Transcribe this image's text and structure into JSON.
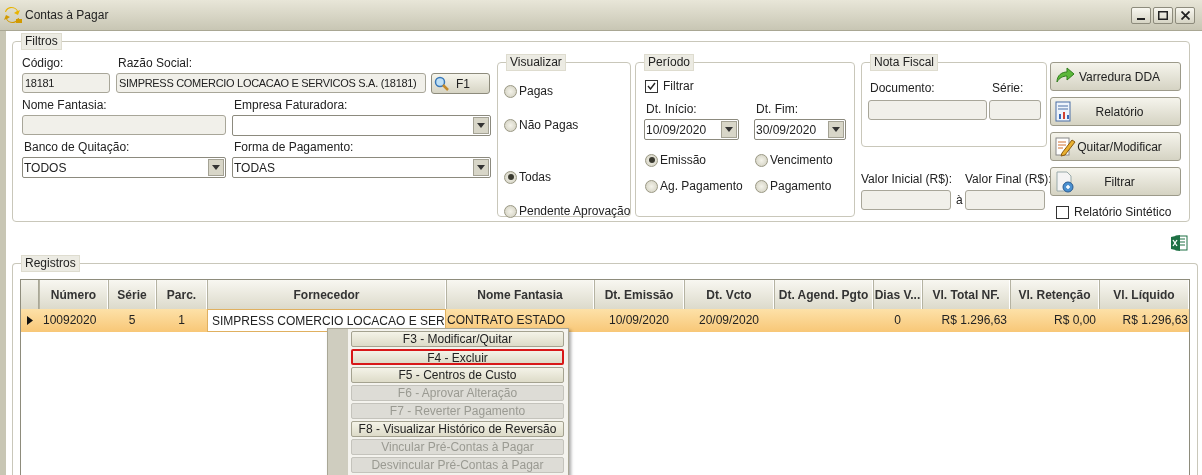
{
  "window": {
    "title": "Contas à Pagar"
  },
  "filtros": {
    "legend": "Filtros",
    "codigo": {
      "label": "Código:",
      "value": "18181"
    },
    "razao_social": {
      "label": "Razão Social:",
      "value": "SIMPRESS COMERCIO LOCACAO E SERVICOS S.A. (18181)"
    },
    "search_button": "F1",
    "nome_fantasia": {
      "label": "Nome Fantasia:"
    },
    "empresa_faturadora": {
      "label": "Empresa Faturadora:"
    },
    "banco_quitacao": {
      "label": "Banco de Quitação:",
      "value": "TODOS"
    },
    "forma_pagamento": {
      "label": "Forma de Pagamento:",
      "value": "TODAS"
    },
    "visualizar": {
      "legend": "Visualizar",
      "options": [
        {
          "label": "Pagas",
          "selected": false
        },
        {
          "label": "Não Pagas",
          "selected": false
        },
        {
          "label": "Todas",
          "selected": true
        },
        {
          "label": "Pendente Aprovação",
          "selected": false
        }
      ]
    },
    "periodo": {
      "legend": "Período",
      "filtrar": {
        "label": "Filtrar",
        "checked": true
      },
      "dt_inicio": {
        "label": "Dt. Início:",
        "value": "10/09/2020"
      },
      "dt_fim": {
        "label": "Dt. Fim:",
        "value": "30/09/2020"
      },
      "options": [
        {
          "label": "Emissão",
          "selected": true
        },
        {
          "label": "Vencimento",
          "selected": false
        },
        {
          "label": "Ag. Pagamento",
          "selected": false
        },
        {
          "label": "Pagamento",
          "selected": false
        }
      ]
    },
    "nota_fiscal": {
      "legend": "Nota Fiscal",
      "documento": {
        "label": "Documento:"
      },
      "serie": {
        "label": "Série:"
      }
    },
    "valor_inicial": {
      "label": "Valor Inicial (R$):"
    },
    "separator": "à",
    "valor_final": {
      "label": "Valor Final (R$):"
    },
    "buttons": [
      "Varredura DDA",
      "Relatório",
      "Quitar/Modificar",
      "Filtrar"
    ],
    "relatorio_sintetico": {
      "label": "Relatório Sintético",
      "checked": false
    }
  },
  "registros": {
    "legend": "Registros",
    "columns": [
      "Número",
      "Série",
      "Parc.",
      "Fornecedor",
      "Nome Fantasia",
      "Dt. Emissão",
      "Dt. Vcto",
      "Dt. Agend. Pgto",
      "Dias V...",
      "Vl. Total NF.",
      "Vl. Retenção",
      "Vl. Líquido"
    ],
    "rows": [
      {
        "selected": true,
        "cells": [
          "10092020",
          "5",
          "1",
          "SIMPRESS COMERCIO LOCACAO E SER",
          "CONTRATO ESTADO",
          "10/09/2020",
          "20/09/2020",
          "",
          "0",
          "R$ 1.296,63",
          "R$ 0,00",
          "R$ 1.296,63"
        ]
      }
    ]
  },
  "context_menu": [
    {
      "label": "F3 - Modificar/Quitar",
      "disabled": false,
      "selected": false
    },
    {
      "label": "F4 - Excluir",
      "disabled": false,
      "selected": true
    },
    {
      "label": "F5 - Centros de Custo",
      "disabled": false,
      "selected": false
    },
    {
      "label": "F6 - Aprovar Alteração",
      "disabled": true,
      "selected": false
    },
    {
      "label": "F7 - Reverter Pagamento",
      "disabled": true,
      "selected": false
    },
    {
      "label": "F8 - Visualizar Histórico de Reversão",
      "disabled": false,
      "selected": false
    },
    {
      "label": "Vincular Pré-Contas à Pagar",
      "disabled": true,
      "selected": false
    },
    {
      "label": "Desvincular Pré-Contas à Pagar",
      "disabled": true,
      "selected": false
    }
  ]
}
